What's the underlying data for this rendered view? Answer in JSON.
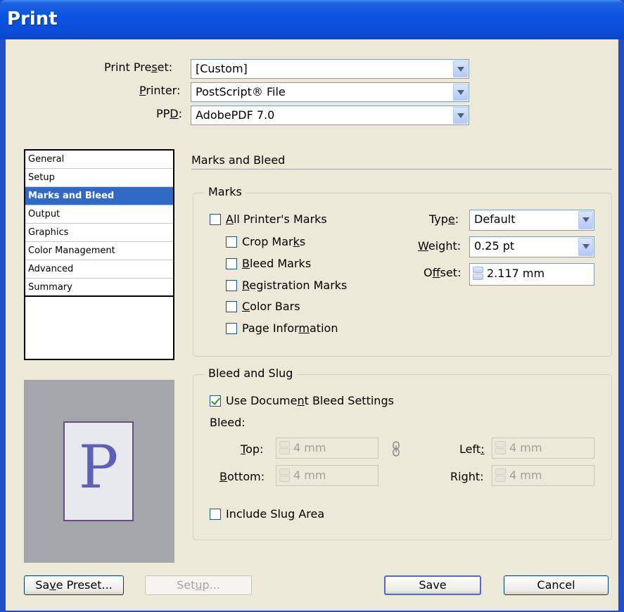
{
  "window": {
    "title": "Print"
  },
  "top": {
    "preset": {
      "label": "Print Pre",
      "label_u": "s",
      "label_post": "et:",
      "value": "[Custom]"
    },
    "printer": {
      "label_u": "P",
      "label_post": "rinter:",
      "value": "PostScript® File"
    },
    "ppd": {
      "label": "PP",
      "label_u": "D",
      "label_post": ":",
      "value": "AdobePDF 7.0"
    }
  },
  "categories": [
    "General",
    "Setup",
    "Marks and Bleed",
    "Output",
    "Graphics",
    "Color Management",
    "Advanced",
    "Summary"
  ],
  "selected_category": "Marks and Bleed",
  "preview": {
    "letter": "P"
  },
  "section": {
    "title": "Marks and Bleed"
  },
  "marks": {
    "group_label": "Marks",
    "all_printers_marks": {
      "u": "A",
      "rest": "ll Printer's Marks",
      "checked": false
    },
    "crop_marks": {
      "pre": "Crop Mar",
      "u": "k",
      "rest": "s",
      "checked": false
    },
    "bleed_marks": {
      "u": "B",
      "rest": "leed Marks",
      "checked": false
    },
    "registration_marks": {
      "u": "R",
      "rest": "egistration Marks",
      "checked": false
    },
    "color_bars": {
      "u": "C",
      "rest": "olor Bars",
      "checked": false
    },
    "page_information": {
      "pre": "Page Infor",
      "u": "m",
      "rest": "ation",
      "checked": false
    },
    "type": {
      "pre": "Typ",
      "u": "e",
      "post": ":",
      "value": "Default"
    },
    "weight": {
      "u": "W",
      "post": "eight:",
      "value": "0.25 pt"
    },
    "offset": {
      "pre": "O",
      "u": "f",
      "post": "fset:",
      "value": "2.117 mm"
    }
  },
  "bleed": {
    "group_label": "Bleed and Slug",
    "use_document": {
      "pre": "Use Docume",
      "u": "n",
      "rest": "t Bleed Settings",
      "checked": true
    },
    "bleed_label": "Bleed:",
    "top": {
      "u": "T",
      "post": "op:",
      "value": "4 mm"
    },
    "bottom": {
      "u": "B",
      "post": "ottom:",
      "value": "4 mm"
    },
    "left": {
      "pre": "Left",
      "u": ":",
      "value": "4 mm"
    },
    "right": {
      "pre": "Ri",
      "u": "g",
      "post": "ht:",
      "value": "4 mm"
    },
    "include_slug": {
      "pre": "Include Slu",
      "u": "g",
      "rest": " Area",
      "checked": false
    }
  },
  "buttons": {
    "save_preset": {
      "pre": "Sa",
      "u": "v",
      "post": "e Preset..."
    },
    "setup": {
      "pre": "Set",
      "u": "u",
      "post": "p..."
    },
    "save": "Save",
    "cancel": "Cancel"
  }
}
